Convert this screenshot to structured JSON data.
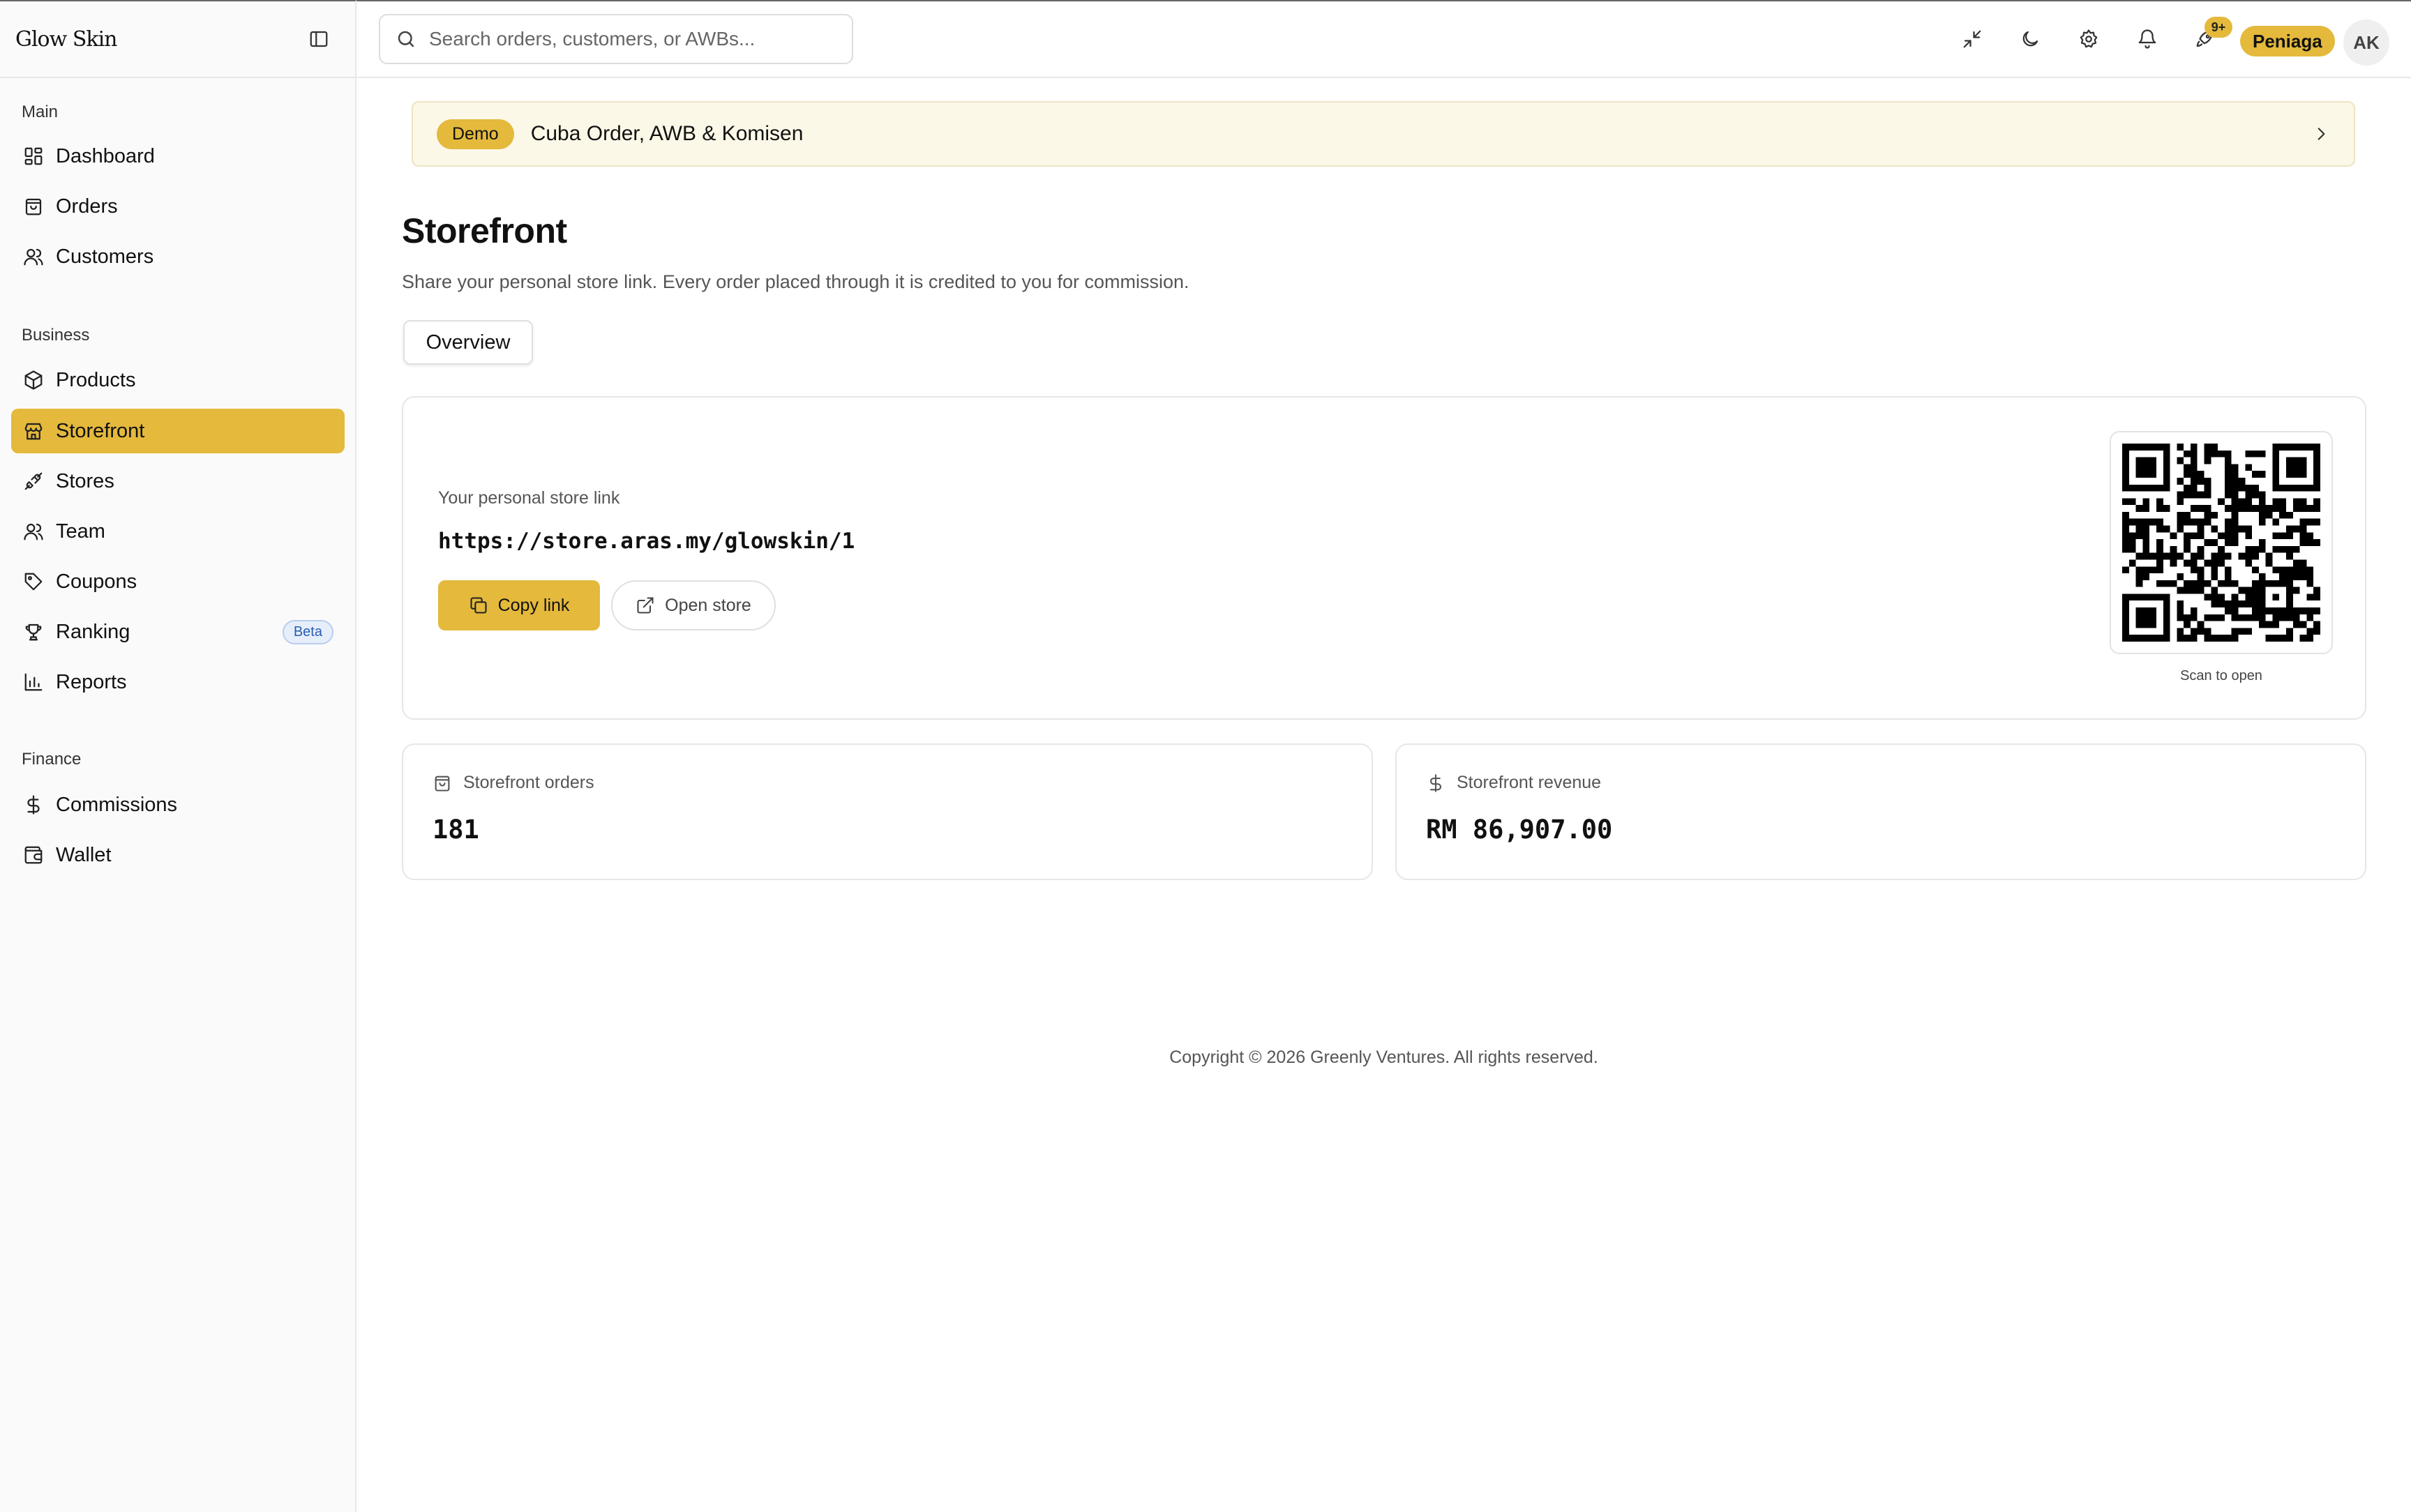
{
  "app": {
    "brand": "Glow Skin"
  },
  "search": {
    "placeholder": "Search orders, customers, or AWBs..."
  },
  "topbar": {
    "notification_badge": "9+",
    "role": "Peniaga",
    "avatar_initials": "AK"
  },
  "sidebar": {
    "groups": [
      {
        "label": "Main",
        "items": [
          {
            "label": "Dashboard",
            "icon": "dashboard-icon"
          },
          {
            "label": "Orders",
            "icon": "shopping-bag-icon"
          },
          {
            "label": "Customers",
            "icon": "users-icon"
          }
        ]
      },
      {
        "label": "Business",
        "items": [
          {
            "label": "Products",
            "icon": "package-icon"
          },
          {
            "label": "Storefront",
            "icon": "store-icon",
            "active": true
          },
          {
            "label": "Stores",
            "icon": "plug-icon"
          },
          {
            "label": "Team",
            "icon": "users-icon"
          },
          {
            "label": "Coupons",
            "icon": "tag-icon"
          },
          {
            "label": "Ranking",
            "icon": "trophy-icon",
            "badge": "Beta"
          },
          {
            "label": "Reports",
            "icon": "bar-chart-icon"
          }
        ]
      },
      {
        "label": "Finance",
        "items": [
          {
            "label": "Commissions",
            "icon": "dollar-icon"
          },
          {
            "label": "Wallet",
            "icon": "wallet-icon"
          }
        ]
      }
    ]
  },
  "banner": {
    "pill": "Demo",
    "text": "Cuba Order, AWB & Komisen"
  },
  "page": {
    "title": "Storefront",
    "subtitle": "Share your personal store link. Every order placed through it is credited to you for commission.",
    "tabs": [
      {
        "label": "Overview",
        "active": true
      }
    ]
  },
  "store_link": {
    "label": "Your personal store link",
    "url": "https://store.aras.my/glowskin/1",
    "copy_label": "Copy link",
    "open_label": "Open store",
    "qr_caption": "Scan to open"
  },
  "stats": [
    {
      "label": "Storefront orders",
      "value": "181",
      "icon": "shopping-bag-icon"
    },
    {
      "label": "Storefront revenue",
      "value": "RM 86,907.00",
      "icon": "dollar-icon"
    }
  ],
  "footer": {
    "text": "Copyright © 2026 Greenly Ventures. All rights reserved."
  },
  "colors": {
    "accent": "#e4b93c",
    "banner_bg": "#fcf8e8",
    "beta_badge": "#2a5db0"
  }
}
